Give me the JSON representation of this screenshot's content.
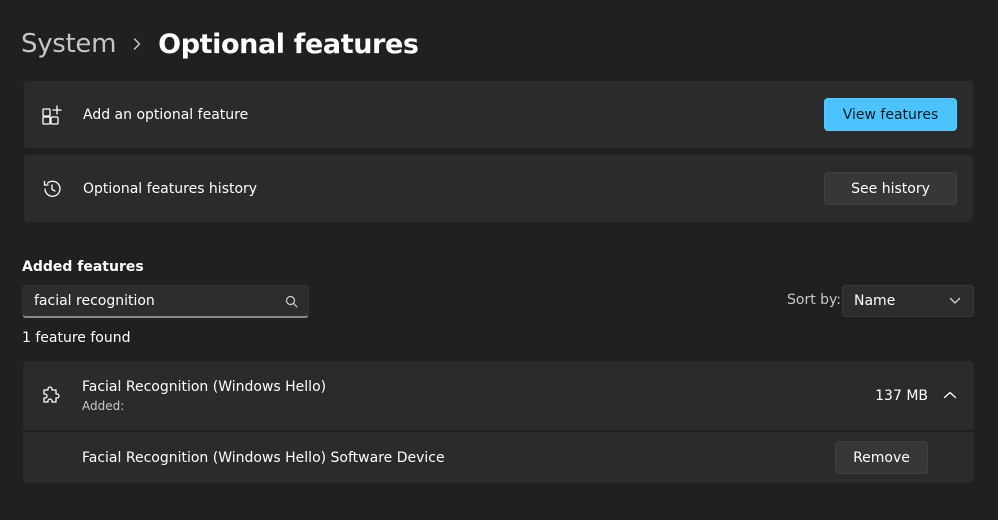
{
  "breadcrumb": {
    "parent": "System",
    "current": "Optional features"
  },
  "cards": {
    "add_feature": {
      "label": "Add an optional feature",
      "button": "View features",
      "icon": "add-apps-icon"
    },
    "history": {
      "label": "Optional features history",
      "button": "See history",
      "icon": "history-icon"
    }
  },
  "added": {
    "title": "Added features",
    "search": {
      "value": "facial recognition",
      "icon": "search-icon"
    },
    "sort": {
      "label": "Sort by:",
      "selected": "Name"
    },
    "found": "1 feature found",
    "items": [
      {
        "name": "Facial Recognition (Windows Hello)",
        "sub": "Added:",
        "size": "137 MB",
        "icon": "puzzle-icon",
        "expanded": true,
        "children": [
          {
            "name": "Facial Recognition (Windows Hello) Software Device",
            "action": "Remove"
          }
        ]
      }
    ]
  },
  "colors": {
    "background": "#202020",
    "card": "#2b2b2b",
    "accent": "#4cc2ff"
  }
}
